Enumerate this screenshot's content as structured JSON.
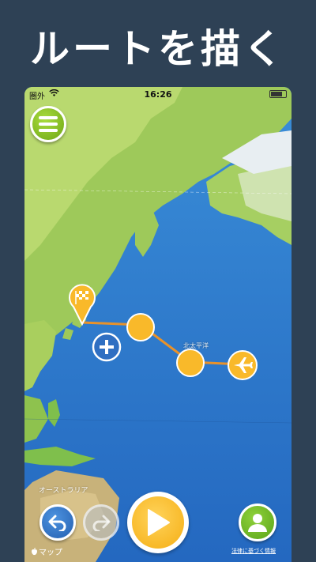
{
  "promo": {
    "title": "ルートを描く"
  },
  "status_bar": {
    "carrier": "圏外",
    "time": "16:26"
  },
  "map": {
    "labels": {
      "pacific": "北太平洋",
      "australia": "オーストラリア"
    },
    "attribution": "マップ",
    "legal": "法律に基づく情報"
  },
  "icons": {
    "menu": "hamburger-icon",
    "start_pin": "checkered-flag-pin-icon",
    "add": "plus-icon",
    "plane": "airplane-icon",
    "undo": "undo-arrow-icon",
    "redo": "redo-arrow-icon",
    "play": "play-icon",
    "profile": "person-icon"
  },
  "colors": {
    "background": "#2e4155",
    "ocean": "#2f7fd0",
    "route_line": "#e8922a",
    "waypoint": "#f9b92a",
    "menu_green": "#7ab51d",
    "undo_blue": "#2f6fc2",
    "play_yellow": "#f7b21c"
  }
}
